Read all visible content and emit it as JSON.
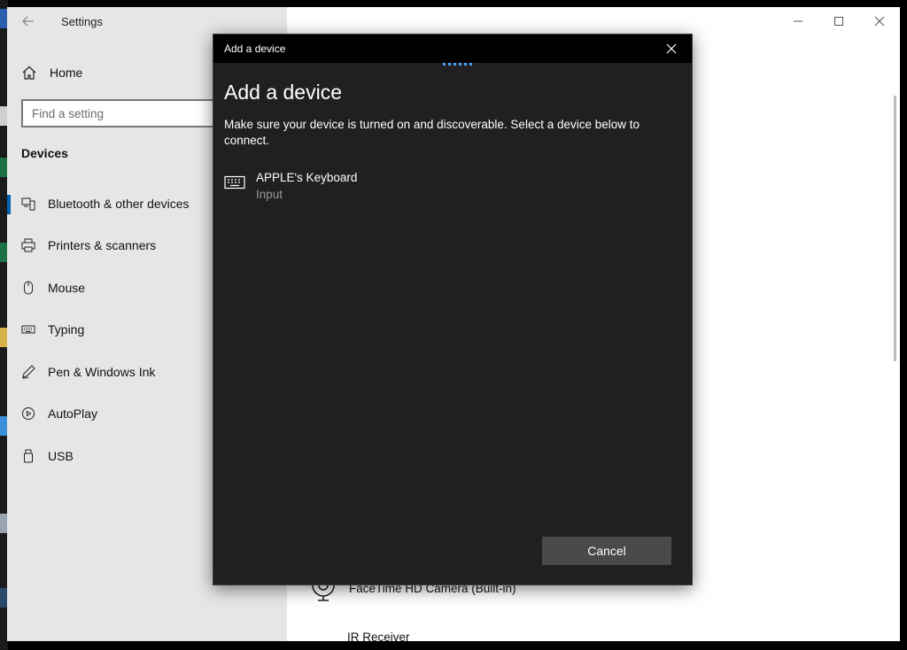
{
  "settings": {
    "title": "Settings",
    "home_label": "Home",
    "search_placeholder": "Find a setting",
    "section_title": "Devices",
    "nav": [
      {
        "label": "Bluetooth & other devices",
        "icon": "bluetooth-devices-icon",
        "selected": true
      },
      {
        "label": "Printers & scanners",
        "icon": "printer-icon",
        "selected": false
      },
      {
        "label": "Mouse",
        "icon": "mouse-icon",
        "selected": false
      },
      {
        "label": "Typing",
        "icon": "keyboard-icon",
        "selected": false
      },
      {
        "label": "Pen & Windows Ink",
        "icon": "pen-icon",
        "selected": false
      },
      {
        "label": "AutoPlay",
        "icon": "autoplay-icon",
        "selected": false
      },
      {
        "label": "USB",
        "icon": "usb-icon",
        "selected": false
      }
    ],
    "background_items": {
      "camera": "FaceTime HD Camera (Built-in)",
      "ir": "IR Receiver"
    }
  },
  "dialog": {
    "titlebar": "Add a device",
    "heading": "Add a device",
    "description": "Make sure your device is turned on and discoverable. Select a device below to connect.",
    "device": {
      "name": "APPLE's Keyboard",
      "type": "Input",
      "icon": "keyboard-icon"
    },
    "cancel_label": "Cancel"
  },
  "colors": {
    "accent": "#0063b1",
    "progress": "#4aa0ff",
    "dialog_bg": "#202020",
    "button_bg": "#4a4a4a"
  }
}
